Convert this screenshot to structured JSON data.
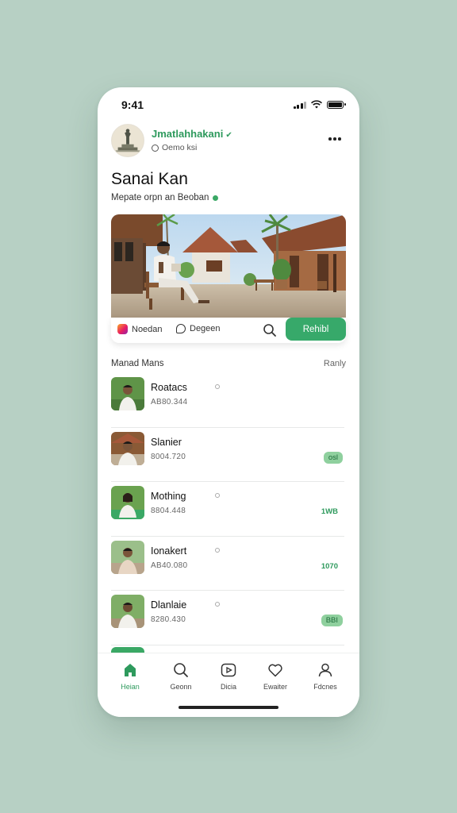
{
  "status_bar": {
    "time": "9:41"
  },
  "profile": {
    "name": "Jmatlahhakani",
    "subtitle": "Oemo ksi",
    "avatar_icon": "statue-avatar-icon",
    "more_icon": "more-horizontal-icon"
  },
  "page": {
    "title": "Sanai Kan",
    "subtitle": "Mepate orpn an Beoban"
  },
  "hero": {
    "image_icon": "hero-photo-man-seated-bench-village"
  },
  "actions": {
    "instagram_label": "Noedan",
    "message_label": "Degeen",
    "search_icon": "search-icon",
    "primary_button": "Rehibl"
  },
  "section": {
    "title": "Manad Mans",
    "link": "Ranly"
  },
  "list_items": [
    {
      "name": "Roatacs",
      "meta": "AB80.344",
      "badge": "",
      "badge_style": "none"
    },
    {
      "name": "Slanier",
      "meta": "8004.720",
      "badge": "osl",
      "badge_style": "pill"
    },
    {
      "name": "Mothing",
      "meta": "8804.448",
      "badge": "1WB",
      "badge_style": "text"
    },
    {
      "name": "Ionakert",
      "meta": "AB40.080",
      "badge": "1070",
      "badge_style": "text"
    },
    {
      "name": "Dlanlaie",
      "meta": "8280.430",
      "badge": "BBI",
      "badge_style": "pill"
    }
  ],
  "tabs": [
    {
      "label": "Heian",
      "icon": "home-icon",
      "active": true
    },
    {
      "label": "Geonn",
      "icon": "search-icon",
      "active": false
    },
    {
      "label": "Dicia",
      "icon": "video-icon",
      "active": false
    },
    {
      "label": "Ewaiter",
      "icon": "heart-icon",
      "active": false
    },
    {
      "label": "Fdcnes",
      "icon": "profile-icon",
      "active": false
    }
  ],
  "colors": {
    "accent": "#37a96a",
    "background": "#b7d0c4",
    "card": "#ffffff"
  }
}
